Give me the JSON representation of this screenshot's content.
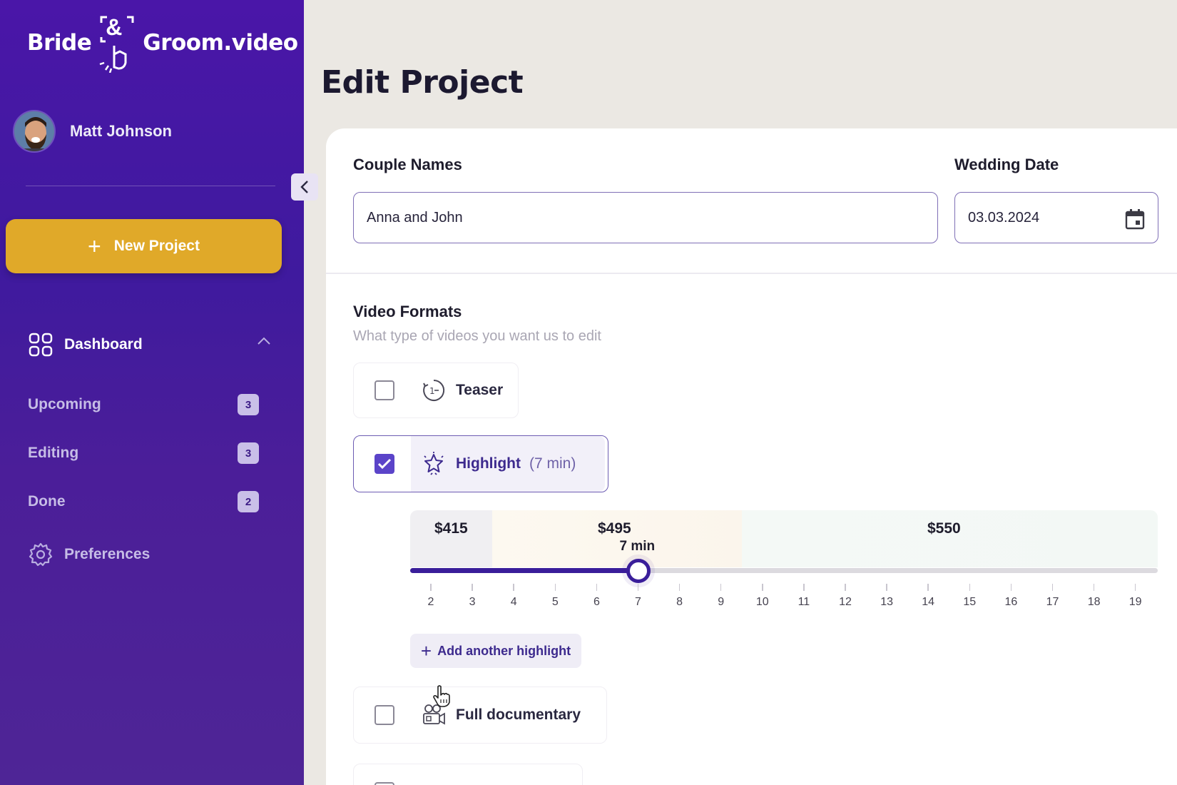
{
  "brand": {
    "name_left": "Bride",
    "amp": "&",
    "name_right": "Groom.video"
  },
  "user": {
    "name": "Matt Johnson"
  },
  "sidebar": {
    "new_project_label": "New Project",
    "dashboard_label": "Dashboard",
    "items": [
      {
        "label": "Upcoming",
        "count": "3"
      },
      {
        "label": "Editing",
        "count": "3"
      },
      {
        "label": "Done",
        "count": "2"
      }
    ],
    "preferences_label": "Preferences"
  },
  "page": {
    "title": "Edit Project"
  },
  "form": {
    "couple_label": "Couple Names",
    "couple_value": "Anna and John",
    "date_label": "Wedding Date",
    "date_value": "03.03.2024"
  },
  "formats": {
    "title": "Video Formats",
    "subtitle": "What type of videos you want us to edit",
    "options": [
      {
        "label": "Teaser",
        "checked": false,
        "icon": "clock-one-minute-icon"
      },
      {
        "label": "Highlight",
        "duration": "(7 min)",
        "checked": true,
        "icon": "sparkle-star-icon"
      },
      {
        "label": "Full documentary",
        "checked": false,
        "icon": "video-camera-icon"
      }
    ]
  },
  "slider": {
    "prices": [
      "$415",
      "$495",
      "$550"
    ],
    "value_label": "7 min",
    "value": 7,
    "min": 2,
    "max": 19,
    "ticks": [
      "2",
      "3",
      "4",
      "5",
      "6",
      "7",
      "8",
      "9",
      "10",
      "11",
      "12",
      "13",
      "14",
      "15",
      "16",
      "17",
      "18",
      "19"
    ],
    "add_label": "Add another highlight"
  },
  "colors": {
    "sidebar": "#4a16a8",
    "accent": "#e0a929",
    "primary": "#3a1e9a"
  }
}
